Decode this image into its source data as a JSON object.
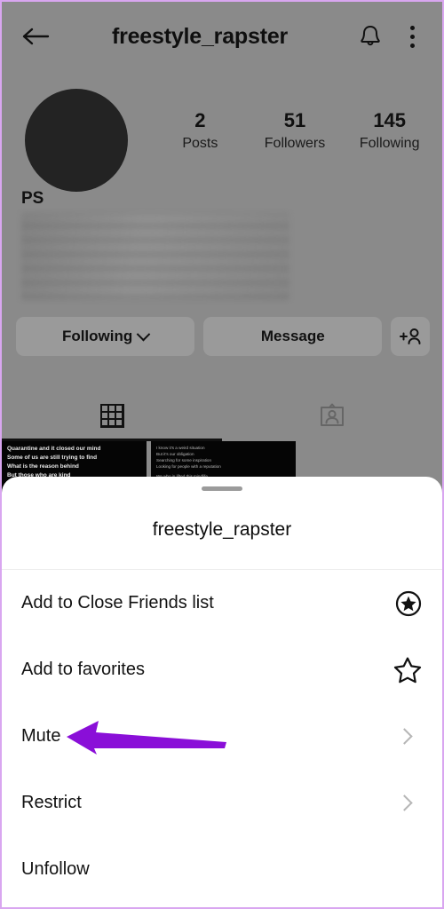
{
  "colors": {
    "annotation_arrow": "#8A0FD8",
    "page_border": "#D9A6F0",
    "dim_overlay": "#8A8A8A",
    "sheet_background": "#FFFFFF",
    "text_primary": "#121212",
    "chevron": "#B6B6B6"
  },
  "profile": {
    "header": {
      "back_icon": "back-arrow-icon",
      "title": "freestyle_rapster",
      "bell_icon": "bell-icon",
      "menu_icon": "kebab-menu-icon"
    },
    "avatar_alt": "profile-photo",
    "stats": [
      {
        "value": "2",
        "label": "Posts"
      },
      {
        "value": "51",
        "label": "Followers"
      },
      {
        "value": "145",
        "label": "Following"
      }
    ],
    "display_name": "PS",
    "actions": {
      "following_label": "Following",
      "message_label": "Message",
      "add_user_icon": "add-person-icon"
    },
    "tabs": [
      {
        "icon": "grid-icon",
        "name": "posts-grid",
        "active": true
      },
      {
        "icon": "tagged-icon",
        "name": "tagged",
        "active": false
      }
    ],
    "posts": [
      {
        "lines": [
          "Quarantine and it closed our mind",
          "Some of us are still trying to find",
          "What is the reason behind",
          "But those who are kind"
        ]
      },
      {
        "lines": [
          "I know it's a weird situation",
          "But it's our obligation",
          "Searching for some inspiration",
          "Looking for people with a reputation",
          "We who in lifted this mindlife"
        ]
      }
    ]
  },
  "sheet": {
    "title": "freestyle_rapster",
    "items": [
      {
        "label": "Add to Close Friends list",
        "trailing": "close-friends-star-icon"
      },
      {
        "label": "Add to favorites",
        "trailing": "favorite-star-icon"
      },
      {
        "label": "Mute",
        "trailing": "chevron-right-icon"
      },
      {
        "label": "Restrict",
        "trailing": "chevron-right-icon"
      },
      {
        "label": "Unfollow",
        "trailing": "none"
      }
    ]
  }
}
